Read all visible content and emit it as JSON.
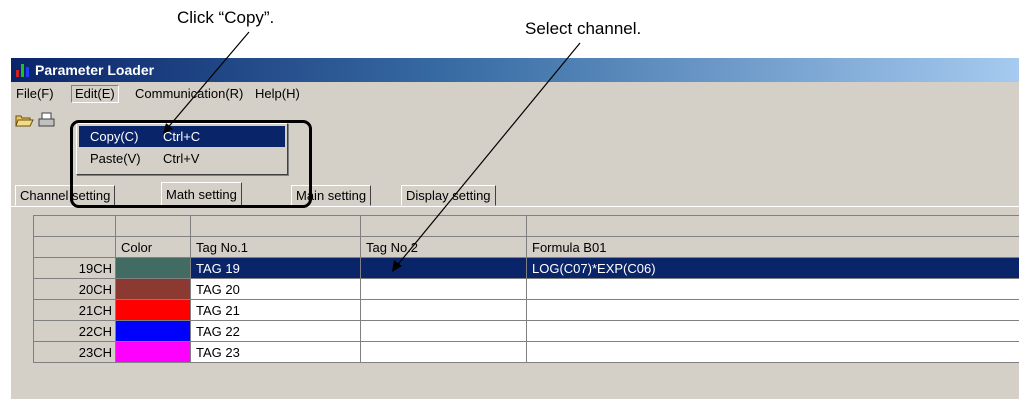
{
  "annotations": {
    "copy_hint": "Click “Copy”.",
    "channel_hint": "Select channel."
  },
  "window": {
    "title": "Parameter Loader",
    "title_bar_color": "#0a246a",
    "icon": "app-icon"
  },
  "menu": {
    "items": [
      "File(F)",
      "Edit(E)",
      "Communication(R)",
      "Help(H)"
    ],
    "open_menu": "Edit(E)"
  },
  "toolbar": {
    "icons": [
      "open-folder-icon",
      "print-icon"
    ]
  },
  "edit_menu": {
    "items": [
      {
        "label": "Copy(C)",
        "shortcut": "Ctrl+C",
        "highlighted": true
      },
      {
        "label": "Paste(V)",
        "shortcut": "Ctrl+V",
        "highlighted": false
      }
    ]
  },
  "tabs": [
    "Channel setting",
    "Math setting",
    "Main setting",
    "Display setting"
  ],
  "active_tab": "Math setting",
  "grid": {
    "columns": [
      "",
      "Color",
      "Tag No.1",
      "Tag No.2",
      "Formula B01"
    ],
    "rows": [
      {
        "channel": "19CH",
        "color": "#426b63",
        "tag1": "TAG 19",
        "tag2": "",
        "formula": "LOG(C07)*EXP(C06)",
        "selected": true
      },
      {
        "channel": "20CH",
        "color": "#8c3a31",
        "tag1": "TAG 20",
        "tag2": "",
        "formula": "",
        "selected": false
      },
      {
        "channel": "21CH",
        "color": "#ff0000",
        "tag1": "TAG 21",
        "tag2": "",
        "formula": "",
        "selected": false
      },
      {
        "channel": "22CH",
        "color": "#0000ff",
        "tag1": "TAG 22",
        "tag2": "",
        "formula": "",
        "selected": false
      },
      {
        "channel": "23CH",
        "color": "#ff00ff",
        "tag1": "TAG 23",
        "tag2": "",
        "formula": "",
        "selected": false
      }
    ]
  }
}
